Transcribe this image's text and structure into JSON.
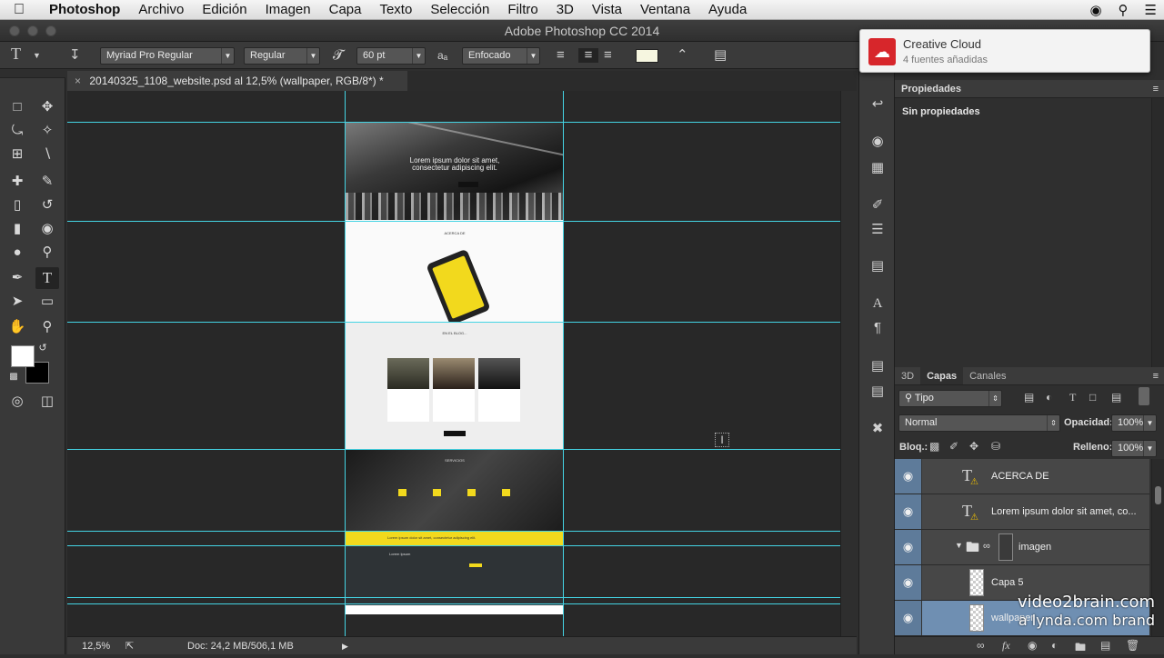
{
  "menubar": {
    "app": "Photoshop",
    "items": [
      "Archivo",
      "Edición",
      "Imagen",
      "Capa",
      "Texto",
      "Selección",
      "Filtro",
      "3D",
      "Vista",
      "Ventana",
      "Ayuda"
    ]
  },
  "window": {
    "title": "Adobe Photoshop CC 2014"
  },
  "options": {
    "font_family": "Myriad Pro Regular",
    "font_style": "Regular",
    "font_size": "60 pt",
    "aa_label": "aₐ",
    "antialias": "Enfocado"
  },
  "document": {
    "tab_label": "20140325_1108_website.psd al 12,5% (wallpaper, RGB/8*) *",
    "close": "×"
  },
  "mock": {
    "hero_line1": "Lorem ipsum dolor sit amet,",
    "hero_line2": "consectetur adipiscing elit.",
    "about_title": "ACERCA DE",
    "blog_title": "EN EL BLOG...",
    "services_title": "SERVICIOS",
    "banner_text": "Lorem ipsum dolor sit amet, consectetur adipiscing elit.",
    "footer_title": "Lorem Ipsum"
  },
  "notification": {
    "title": "Creative Cloud",
    "subtitle": "4 fuentes añadidas"
  },
  "properties": {
    "title": "Propiedades",
    "content": "Sin propiedades"
  },
  "layers_panel": {
    "tabs": [
      "3D",
      "Capas",
      "Canales"
    ],
    "filter": "Tipo",
    "blend": "Normal",
    "opacity_label": "Opacidad:",
    "opacity": "100%",
    "lock_label": "Bloq.:",
    "fill_label": "Relleno:",
    "fill": "100%"
  },
  "layers": [
    {
      "name": "ACERCA DE",
      "kind": "text"
    },
    {
      "name": "Lorem ipsum dolor sit amet, co...",
      "kind": "text"
    },
    {
      "name": "imagen",
      "kind": "group"
    },
    {
      "name": "Capa 5",
      "kind": "pixel"
    },
    {
      "name": "wallpaper",
      "kind": "pixel"
    }
  ],
  "status": {
    "zoom": "12,5%",
    "doc": "Doc: 24,2 MB/506,1 MB"
  },
  "watermark": {
    "line1": "video2brain.com",
    "line2": "a lynda.com brand"
  }
}
